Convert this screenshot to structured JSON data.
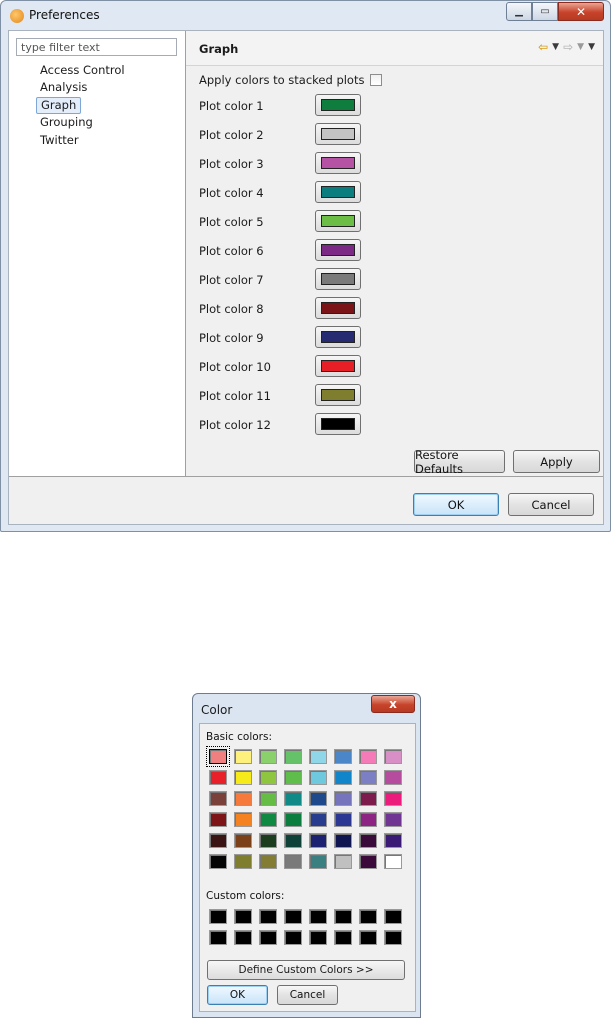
{
  "preferences": {
    "title": "Preferences",
    "filter_placeholder": "type filter text",
    "tree": [
      {
        "label": "Access Control"
      },
      {
        "label": "Analysis"
      },
      {
        "label": "Graph"
      },
      {
        "label": "Grouping"
      },
      {
        "label": "Twitter"
      }
    ],
    "selected_item": "Graph",
    "page_title": "Graph",
    "stacked_label": "Apply colors to stacked plots",
    "stacked_checked": false,
    "plot_colors": [
      {
        "label": "Plot color 1",
        "color": "#0f7d3e"
      },
      {
        "label": "Plot color 2",
        "color": "#c4c4c4"
      },
      {
        "label": "Plot color 3",
        "color": "#b552a3"
      },
      {
        "label": "Plot color 4",
        "color": "#0a7d7f"
      },
      {
        "label": "Plot color 5",
        "color": "#6cbd45"
      },
      {
        "label": "Plot color 6",
        "color": "#7b2984"
      },
      {
        "label": "Plot color 7",
        "color": "#7a7a7a"
      },
      {
        "label": "Plot color 8",
        "color": "#7a1416"
      },
      {
        "label": "Plot color 9",
        "color": "#252a71"
      },
      {
        "label": "Plot color 10",
        "color": "#e51f25"
      },
      {
        "label": "Plot color 11",
        "color": "#7f7d2e"
      },
      {
        "label": "Plot color 12",
        "color": "#000000"
      }
    ],
    "restore_defaults_label": "Restore Defaults",
    "apply_label": "Apply",
    "ok_label": "OK",
    "cancel_label": "Cancel"
  },
  "color_dialog": {
    "title": "Color",
    "close_label": "x",
    "basic_colors_label": "Basic colors:",
    "basic_colors": [
      "#f08080",
      "#fdf07c",
      "#8bd16b",
      "#66c268",
      "#8fd7e8",
      "#4a86c8",
      "#f57ab8",
      "#d88fc5",
      "#e8202a",
      "#f7ea1a",
      "#8ec640",
      "#5fbd4c",
      "#6ec9df",
      "#1185c9",
      "#7d7fc4",
      "#b64c9e",
      "#7a403a",
      "#f57a3c",
      "#66bd45",
      "#0f8a87",
      "#1e4a8c",
      "#7674bc",
      "#7e1b4d",
      "#ec1c7c",
      "#7d1418",
      "#f58220",
      "#108a43",
      "#0b7d3f",
      "#283d8e",
      "#2b3792",
      "#8d2382",
      "#703592",
      "#3a1313",
      "#7c4019",
      "#1d3e1e",
      "#0e4238",
      "#1c2271",
      "#0f1550",
      "#3a0b3a",
      "#3b1a76",
      "#050505",
      "#7f7d2e",
      "#827c34",
      "#7a7a7a",
      "#3a8080",
      "#c0c0c0",
      "#3b0a3a",
      "#ffffff"
    ],
    "selected_basic_index": 0,
    "custom_colors_label": "Custom colors:",
    "custom_colors": [
      "#000000",
      "#000000",
      "#000000",
      "#000000",
      "#000000",
      "#000000",
      "#000000",
      "#000000",
      "#000000",
      "#000000",
      "#000000",
      "#000000",
      "#000000",
      "#000000",
      "#000000",
      "#000000"
    ],
    "define_custom_label": "Define Custom Colors >>",
    "ok_label": "OK",
    "cancel_label": "Cancel"
  }
}
